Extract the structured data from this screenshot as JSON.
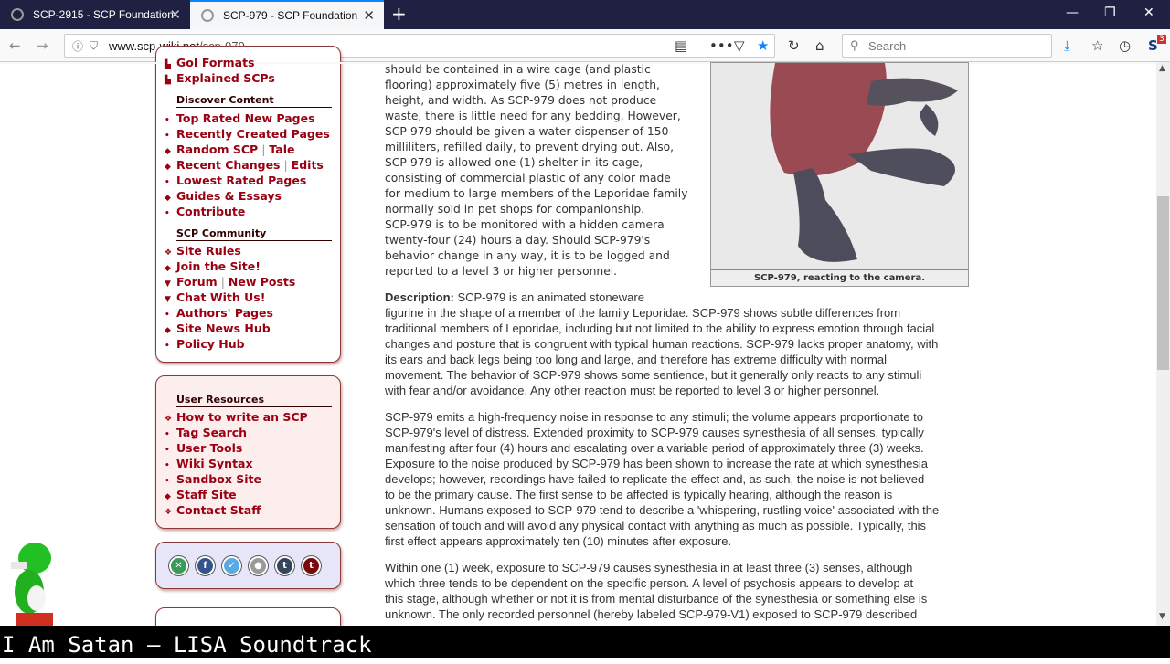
{
  "browser": {
    "tabs": [
      {
        "title": "SCP-2915 - SCP Foundation",
        "active": false
      },
      {
        "title": "SCP-979 - SCP Foundation",
        "active": true
      }
    ],
    "new_tab": "+",
    "close": "✕",
    "url_host": "www.scp-wiki.net",
    "url_path": "/scp-979",
    "search_placeholder": "Search",
    "ext_badge": "3",
    "accent": "#0a84ff"
  },
  "sidebar": {
    "top_items": [
      {
        "label": "GoI Formats"
      },
      {
        "label": "Explained SCPs"
      }
    ],
    "discover_heading": "Discover Content",
    "discover": [
      {
        "bul": "•",
        "parts": [
          "Top Rated New Pages"
        ]
      },
      {
        "bul": "•",
        "parts": [
          "Recently Created Pages"
        ]
      },
      {
        "bul": "◆",
        "parts": [
          "Random SCP",
          "Tale"
        ]
      },
      {
        "bul": "◆",
        "parts": [
          "Recent Changes",
          "Edits"
        ]
      },
      {
        "bul": "•",
        "parts": [
          "Lowest Rated Pages"
        ]
      },
      {
        "bul": "◆",
        "parts": [
          "Guides & Essays"
        ]
      },
      {
        "bul": "•",
        "parts": [
          "Contribute"
        ]
      }
    ],
    "community_heading": "SCP Community",
    "community": [
      {
        "bul": "❖",
        "parts": [
          "Site Rules"
        ]
      },
      {
        "bul": "◆",
        "parts": [
          "Join the Site!"
        ]
      },
      {
        "bul": "▼",
        "parts": [
          "Forum",
          "New Posts"
        ]
      },
      {
        "bul": "▼",
        "parts": [
          "Chat With Us!"
        ]
      },
      {
        "bul": "•",
        "parts": [
          "Authors' Pages"
        ]
      },
      {
        "bul": "◆",
        "parts": [
          "Site News Hub"
        ]
      },
      {
        "bul": "•",
        "parts": [
          "Policy Hub"
        ]
      }
    ],
    "resources_heading": "User Resources",
    "resources": [
      {
        "bul": "❖",
        "parts": [
          "How to write an SCP"
        ]
      },
      {
        "bul": "•",
        "parts": [
          "Tag Search"
        ]
      },
      {
        "bul": "•",
        "parts": [
          "User Tools"
        ]
      },
      {
        "bul": "•",
        "parts": [
          "Wiki Syntax"
        ]
      },
      {
        "bul": "•",
        "parts": [
          "Sandbox Site"
        ]
      },
      {
        "bul": "◆",
        "parts": [
          "Staff Site"
        ]
      },
      {
        "bul": "❖",
        "parts": [
          "Contact Staff"
        ]
      }
    ],
    "social": [
      {
        "icon": "wikidot-icon",
        "glyph": "✕",
        "color": "#3a9a5a"
      },
      {
        "icon": "facebook-icon",
        "glyph": "f",
        "color": "#34558b"
      },
      {
        "icon": "twitter-icon",
        "glyph": "✓",
        "color": "#5aa9e0"
      },
      {
        "icon": "reddit-icon",
        "glyph": "●",
        "color": "#999"
      },
      {
        "icon": "tumblr-icon",
        "glyph": "t",
        "color": "#35465c"
      },
      {
        "icon": "tumblr-red-icon",
        "glyph": "t",
        "color": "#7a0a0a"
      }
    ]
  },
  "content": {
    "containment_lines": [
      "should be contained in a wire cage (and plastic",
      "flooring) approximately five (5) metres in length,",
      "height, and width. As SCP-979 does not produce",
      "waste, there is little need for any bedding. However,",
      "SCP-979 should be given a water dispenser of 150",
      "milliliters, refilled daily, to prevent drying out. Also,",
      "SCP-979 is allowed one (1) shelter in its cage,",
      "consisting of commercial plastic of any color made",
      "for medium to large members of the Leporidae family",
      "normally sold in pet shops for companionship.",
      "SCP-979 is to be monitored with a hidden camera",
      "twenty-four (24) hours a day. Should SCP-979's",
      "behavior change in any way, it is to be logged and",
      "reported to a level 3 or higher personnel."
    ],
    "image_caption": "SCP-979, reacting to the camera.",
    "description_label": "Description:",
    "description_lines": [
      " SCP-979 is an animated stoneware",
      "figurine in the shape of a member of the family Leporidae. SCP-979 shows subtle differences from",
      "traditional members of Leporidae, including but not limited to the ability to express emotion through facial",
      "changes and posture that is congruent with typical human reactions. SCP-979 lacks proper anatomy, with",
      "its ears and back legs being too long and large, and therefore has extreme difficulty with normal",
      "movement. The behavior of SCP-979 shows some sentience, but it generally only reacts to any stimuli",
      "with fear and/or avoidance. Any other reaction must be reported to level 3 or higher personnel."
    ],
    "para2_lines": [
      "SCP-979 emits a high-frequency noise in response to any stimuli; the volume appears proportionate to",
      "SCP-979's level of distress. Extended proximity to SCP-979 causes synesthesia of all senses, typically",
      "manifesting after four (4) hours and escalating over a variable period of approximately three (3) weeks.",
      "Exposure to the noise produced by SCP-979 has been shown to increase the rate at which synesthesia",
      "develops; however, recordings have failed to replicate the effect and, as such, the noise is not believed",
      "to be the primary cause. The first sense to be affected is typically hearing, although the reason is",
      "unknown. Humans exposed to SCP-979 tend to describe a 'whispering, rustling voice' associated with the",
      "sensation of touch and will avoid any physical contact with anything as much as possible. Typically, this",
      "first effect appears approximately ten (10) minutes after exposure."
    ],
    "para3_lines": [
      "Within one (1) week, exposure to SCP-979 causes synesthesia in at least three (3) senses, although",
      "which three tends to be dependent on the specific person. A level of psychosis appears to develop at",
      "this stage, although whether or not it is from mental disturbance of the synesthesia or something else is",
      "unknown. The only recorded personnel (hereby labeled SCP-979-V1) exposed to SCP-979 described"
    ]
  },
  "overlay": {
    "caption": "I Am Satan — LISA Soundtrack"
  }
}
